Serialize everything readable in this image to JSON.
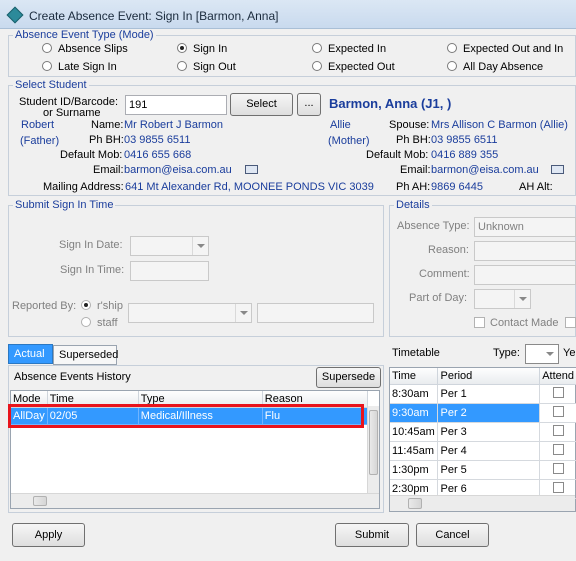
{
  "window": {
    "title": "Create Absence Event: Sign In [Barmon, Anna]"
  },
  "absence_type": {
    "legend": "Absence Event Type (Mode)",
    "options": [
      {
        "label": "Absence Slips",
        "selected": false
      },
      {
        "label": "Sign In",
        "selected": true
      },
      {
        "label": "Expected In",
        "selected": false
      },
      {
        "label": "Expected Out and In",
        "selected": false
      },
      {
        "label": "Late Sign In",
        "selected": false
      },
      {
        "label": "Sign Out",
        "selected": false
      },
      {
        "label": "Expected Out",
        "selected": false
      },
      {
        "label": "All Day Absence",
        "selected": false
      }
    ]
  },
  "select_student": {
    "legend": "Select Student",
    "id_label_1": "Student ID/Barcode:",
    "id_label_2": "or Surname",
    "id_value": "191",
    "select_button": "Select",
    "ellipsis_button": "...",
    "student_name": "Barmon, Anna (J1, )",
    "father": {
      "name_1": "Robert",
      "relation": "(Father)",
      "name_label": "Name:",
      "name": "Mr Robert J Barmon",
      "phbh_label": "Ph BH:",
      "phbh": "03 9855 6511",
      "mob_label": "Default Mob:",
      "mob": "0416 655 668",
      "email_label": "Email:",
      "email": "barmon@eisa.com.au",
      "addr_label": "Mailing Address:",
      "addr": "641 Mt Alexander Rd, MOONEE PONDS VIC 3039"
    },
    "mother": {
      "name_1": "Allie",
      "relation": "(Mother)",
      "spouse_label": "Spouse:",
      "spouse": "Mrs Allison C Barmon (Allie)",
      "phbh_label": "Ph BH:",
      "phbh": "03 9855 6511",
      "mob_label": "Default Mob:",
      "mob": "0416 889 355",
      "email_label": "Email:",
      "email": "barmon@eisa.com.au",
      "phah_label": "Ph AH:",
      "phah": "9869 6445",
      "ahalt_label": "AH Alt:"
    }
  },
  "sign_in": {
    "legend": "Submit Sign In Time",
    "date_label": "Sign In Date:",
    "time_label": "Sign In Time:",
    "reported_label": "Reported By:",
    "rship_label": "r'ship",
    "staff_label": "staff"
  },
  "details": {
    "legend": "Details",
    "type_label": "Absence Type:",
    "type_value": "Unknown",
    "reason_label": "Reason:",
    "comment_label": "Comment:",
    "part_label": "Part of Day:",
    "contact_label": "Contact Made"
  },
  "history": {
    "tabs": [
      "Actual",
      "Superseded"
    ],
    "title": "Absence Events History",
    "supersede_button": "Supersede",
    "columns": [
      "Mode",
      "Time",
      "Type",
      "Reason"
    ],
    "rows": [
      {
        "mode": "AllDay",
        "time": "02/05",
        "type": "Medical/Illness",
        "reason": "Flu"
      }
    ]
  },
  "timetable": {
    "title": "Timetable",
    "type_label": "Type:",
    "ye_label": "Ye",
    "columns": [
      "Time",
      "Period",
      "Attend"
    ],
    "rows": [
      {
        "time": "8:30am",
        "period": "Per 1",
        "selected": false
      },
      {
        "time": "9:30am",
        "period": "Per 2",
        "selected": true
      },
      {
        "time": "10:45am",
        "period": "Per 3",
        "selected": false
      },
      {
        "time": "11:45am",
        "period": "Per 4",
        "selected": false
      },
      {
        "time": "1:30pm",
        "period": "Per 5",
        "selected": false
      },
      {
        "time": "2:30pm",
        "period": "Per 6",
        "selected": false
      }
    ]
  },
  "buttons": {
    "apply": "Apply",
    "submit": "Submit",
    "cancel": "Cancel"
  },
  "colors": {
    "accent": "#1a3d9c",
    "selection": "#3399ff",
    "highlight_border": "#e8141c"
  }
}
